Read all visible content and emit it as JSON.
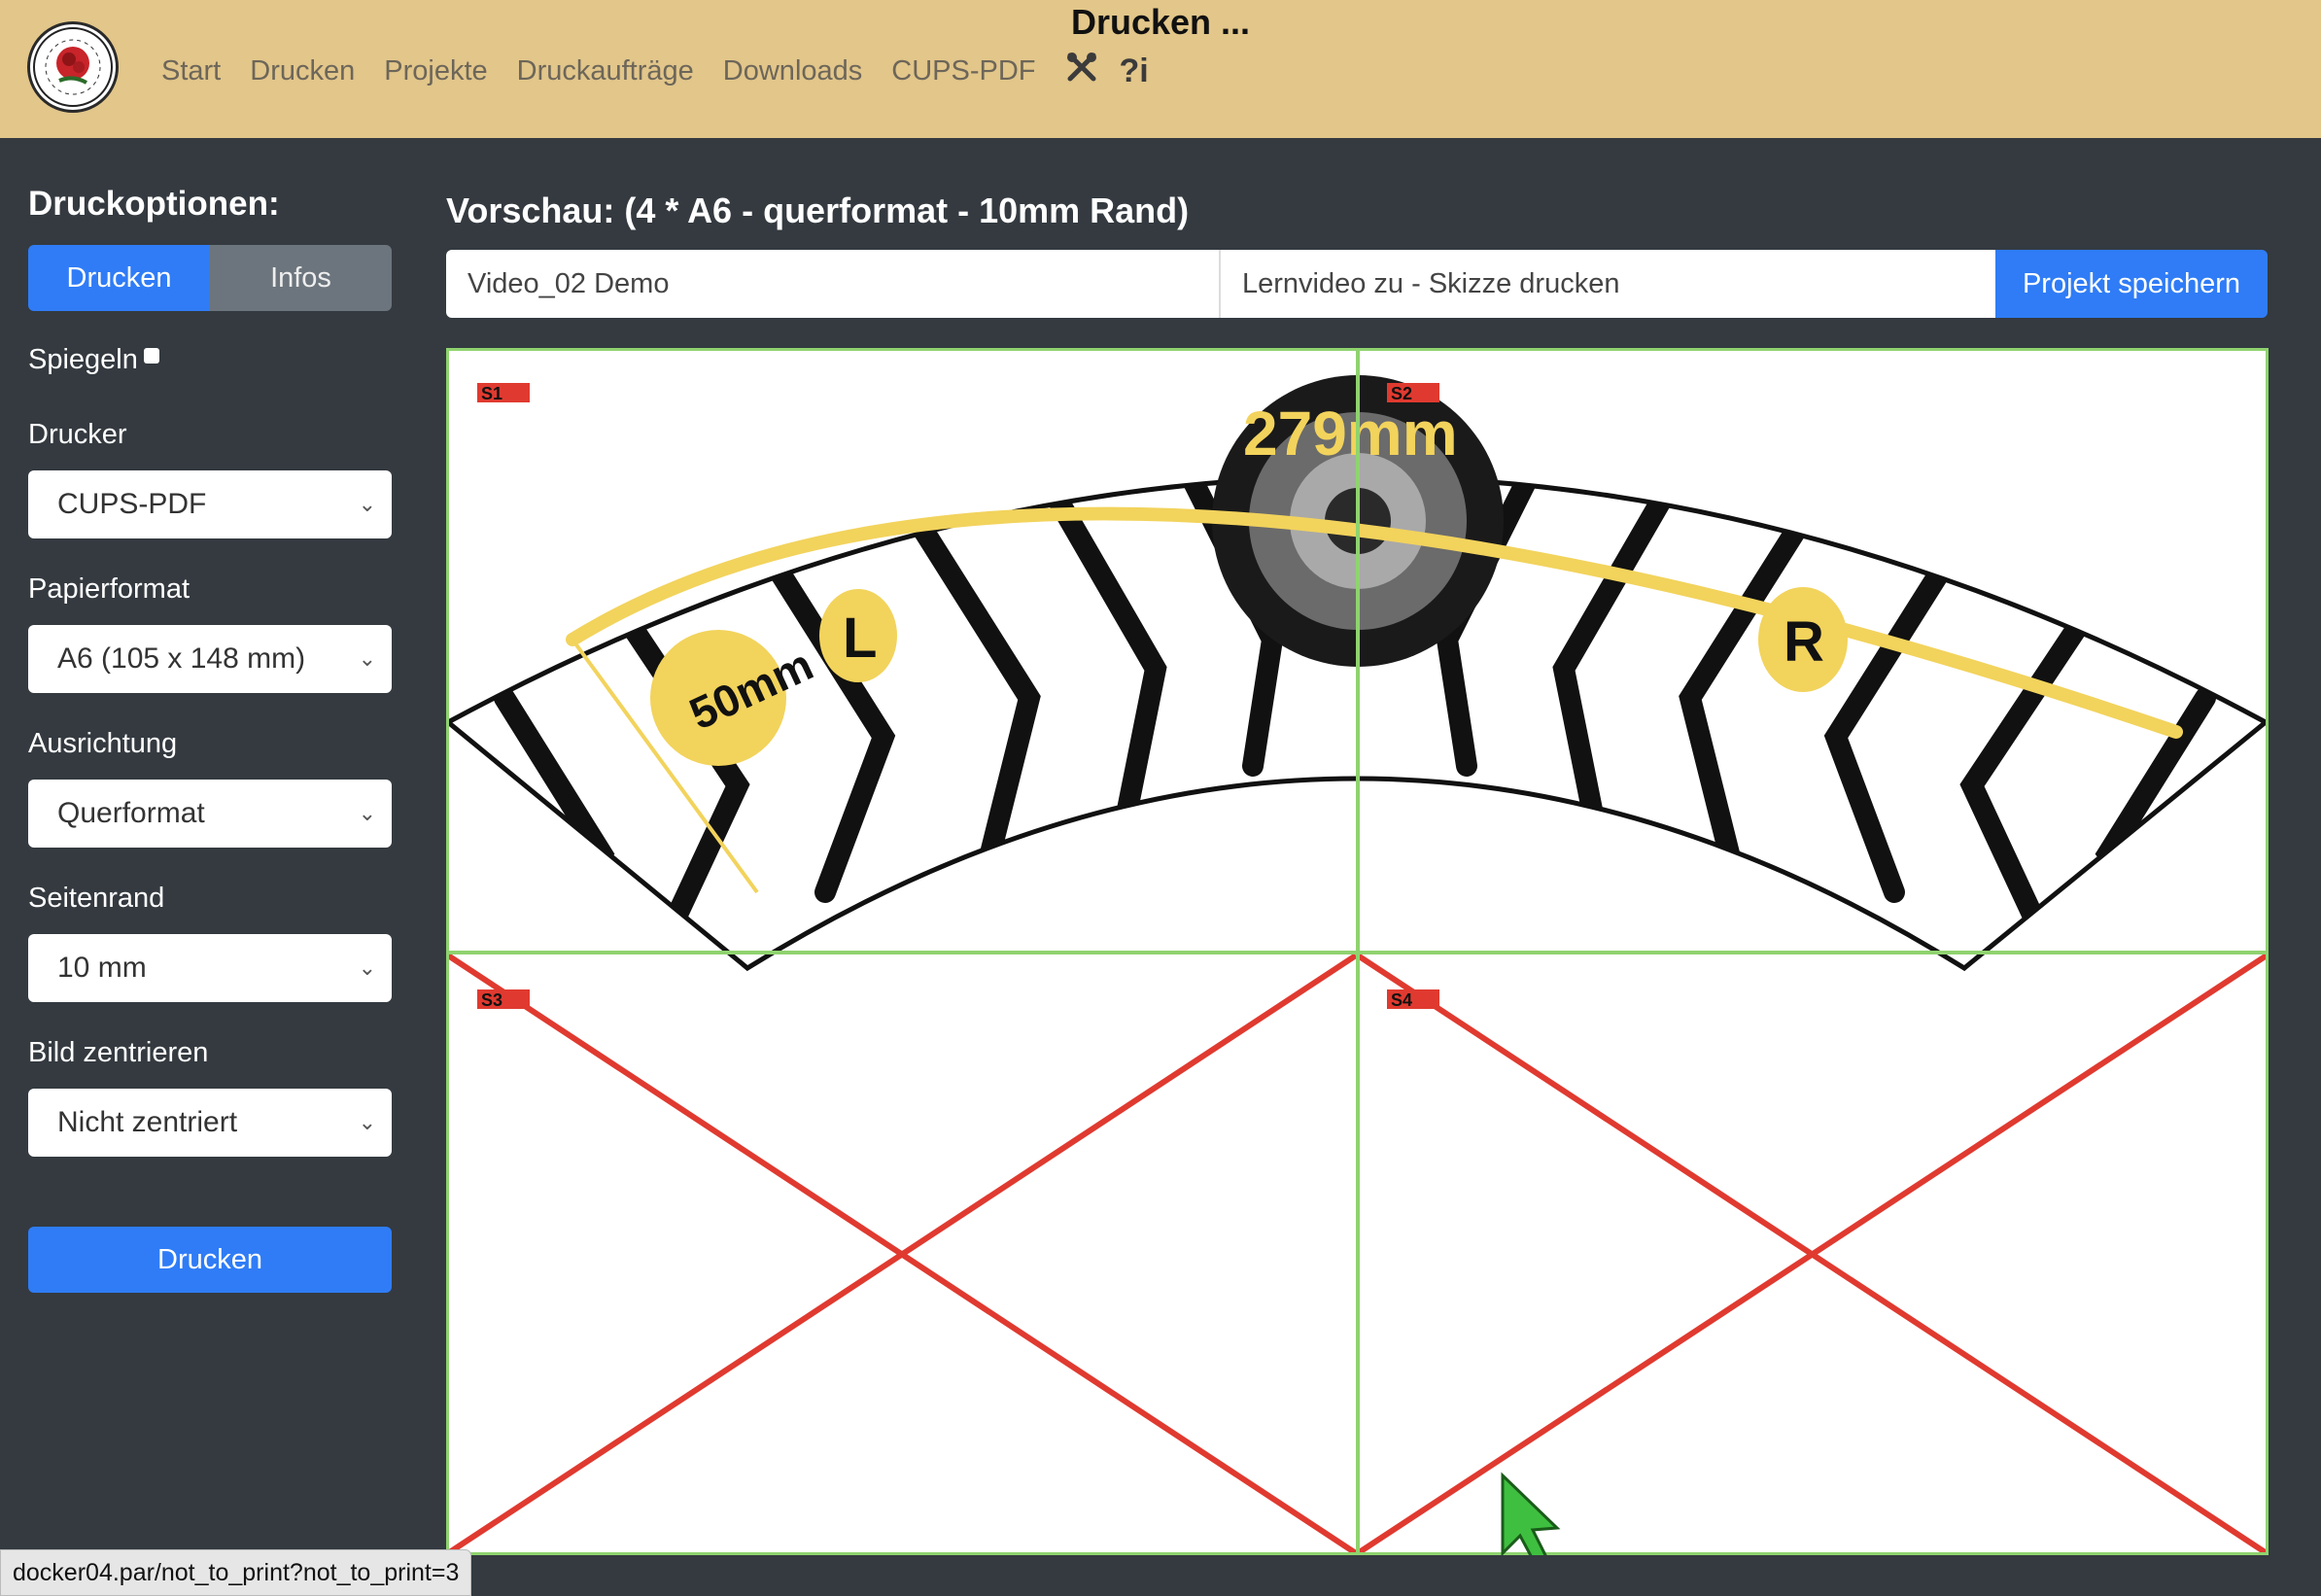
{
  "header": {
    "title": "Drucken ...",
    "nav": [
      "Start",
      "Drucken",
      "Projekte",
      "Druckaufträge",
      "Downloads",
      "CUPS-PDF"
    ],
    "icons": [
      "tools-icon",
      "help-icon"
    ]
  },
  "sidebar": {
    "heading": "Druckoptionen:",
    "tabs": {
      "print": "Drucken",
      "info": "Infos"
    },
    "mirror_label": "Spiegeln",
    "printer": {
      "label": "Drucker",
      "value": "CUPS-PDF"
    },
    "paper": {
      "label": "Papierformat",
      "value": "A6 (105 x 148 mm)"
    },
    "orientation": {
      "label": "Ausrichtung",
      "value": "Querformat"
    },
    "margin": {
      "label": "Seitenrand",
      "value": "10 mm"
    },
    "center": {
      "label": "Bild zentrieren",
      "value": "Nicht zentriert"
    },
    "print_button": "Drucken"
  },
  "preview": {
    "title": "Vorschau: (4 * A6 - querformat - 10mm Rand)",
    "project_name": "Video_02 Demo",
    "project_description": "Lernvideo zu  - Skizze drucken",
    "save_button": "Projekt speichern",
    "sheets": [
      "S1",
      "S2",
      "S3",
      "S4"
    ],
    "sketch_labels": {
      "length": "279mm",
      "width": "50mm",
      "left": "L",
      "right": "R"
    }
  },
  "status_url": "docker04.par/not_to_print?not_to_print=3",
  "colors": {
    "header_bg": "#e2c68a",
    "body_bg": "#343a40",
    "primary": "#2f7cf6",
    "secondary": "#6c757d",
    "grid_line": "#8fd36f",
    "cross": "#e03a30",
    "sketch_yellow": "#f2d35c"
  }
}
